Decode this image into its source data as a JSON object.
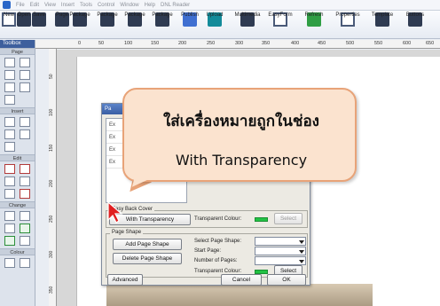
{
  "menubar": {
    "items": [
      "File",
      "Edit",
      "View",
      "Insert",
      "Tools",
      "Control",
      "Window",
      "Help",
      "DNL Reader"
    ]
  },
  "toolbar": {
    "buttons": [
      {
        "label": "New",
        "icon": "new-icon"
      },
      {
        "label": "Open",
        "icon": "open-icon"
      },
      {
        "label": "Save",
        "icon": "save-icon"
      },
      {
        "label": "Page",
        "icon": "page-icon"
      },
      {
        "label": "Package",
        "icon": "package-icon"
      },
      {
        "label": "Package",
        "icon": "package-icon"
      },
      {
        "label": "Package",
        "icon": "package-icon"
      },
      {
        "label": "Package",
        "icon": "package-icon"
      },
      {
        "label": "Publish",
        "icon": "publish-icon"
      },
      {
        "label": "Upload",
        "icon": "upload-icon"
      },
      {
        "label": "Multimedia",
        "icon": "multimedia-icon"
      },
      {
        "label": "EasyForm",
        "icon": "easyform-icon"
      },
      {
        "label": "Refresh",
        "icon": "refresh-icon"
      },
      {
        "label": "Properties",
        "icon": "properties-icon"
      },
      {
        "label": "Template",
        "icon": "template-icon"
      },
      {
        "label": "Buttons",
        "icon": "buttons-icon"
      }
    ]
  },
  "leftpanel": {
    "title": "Toolbox",
    "groups": [
      "Page",
      "Insert",
      "Edit",
      "Change",
      "Colour"
    ]
  },
  "ruler": {
    "top_ticks": [
      "0",
      "50",
      "100",
      "150",
      "200",
      "250",
      "300",
      "350",
      "400",
      "450",
      "500",
      "550",
      "600",
      "650"
    ],
    "left_ticks": [
      "50",
      "100",
      "150",
      "200",
      "250",
      "300",
      "350"
    ]
  },
  "dialog": {
    "title": "Pa",
    "list_rows": [
      "Ex",
      "Ex",
      "Ex",
      "Ex"
    ],
    "easy_back_cover": "Easy Back Cover",
    "with_transparency": "With Transparency",
    "transparent_colour": "Transparent Colour:",
    "select": "Select",
    "page_shape": "Page Shape",
    "add_page_shape": "Add Page Shape",
    "delete_page_shape": "Delete Page Shape",
    "select_page_shape": "Select Page Shape:",
    "start_page": "Start Page:",
    "number_of_pages": "Number of Pages:",
    "transparent_colour_2": "Transparent Colour:",
    "select_2": "Select",
    "advanced": "Advanced",
    "cancel": "Cancel",
    "ok": "OK",
    "swatch_color": "#22c244"
  },
  "callout": {
    "line1": "ใส่เครื่องหมายถูกในช่อง",
    "line2": "With Transparency"
  },
  "colors": {
    "callout_fill": "#fbe3cf",
    "callout_border": "#e8a378",
    "title_bar": "#3a5ea4"
  }
}
